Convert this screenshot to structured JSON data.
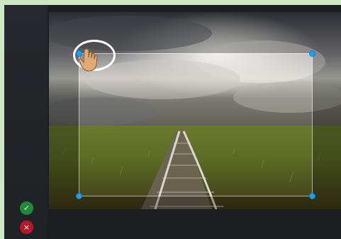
{
  "app": {
    "toolbar": {
      "confirm_label": "✓",
      "cancel_label": "×",
      "confirm_icon": "check-icon",
      "cancel_icon": "close-icon"
    },
    "canvas": {
      "tool": "crop",
      "handles": [
        "top-left",
        "top-right",
        "bottom-left",
        "bottom-right"
      ],
      "accent_color": "#1da1f2"
    }
  },
  "colors": {
    "background": "#cfe6c4",
    "app": "#1e2024",
    "confirm": "#1e8a3c",
    "cancel": "#b4182a"
  }
}
